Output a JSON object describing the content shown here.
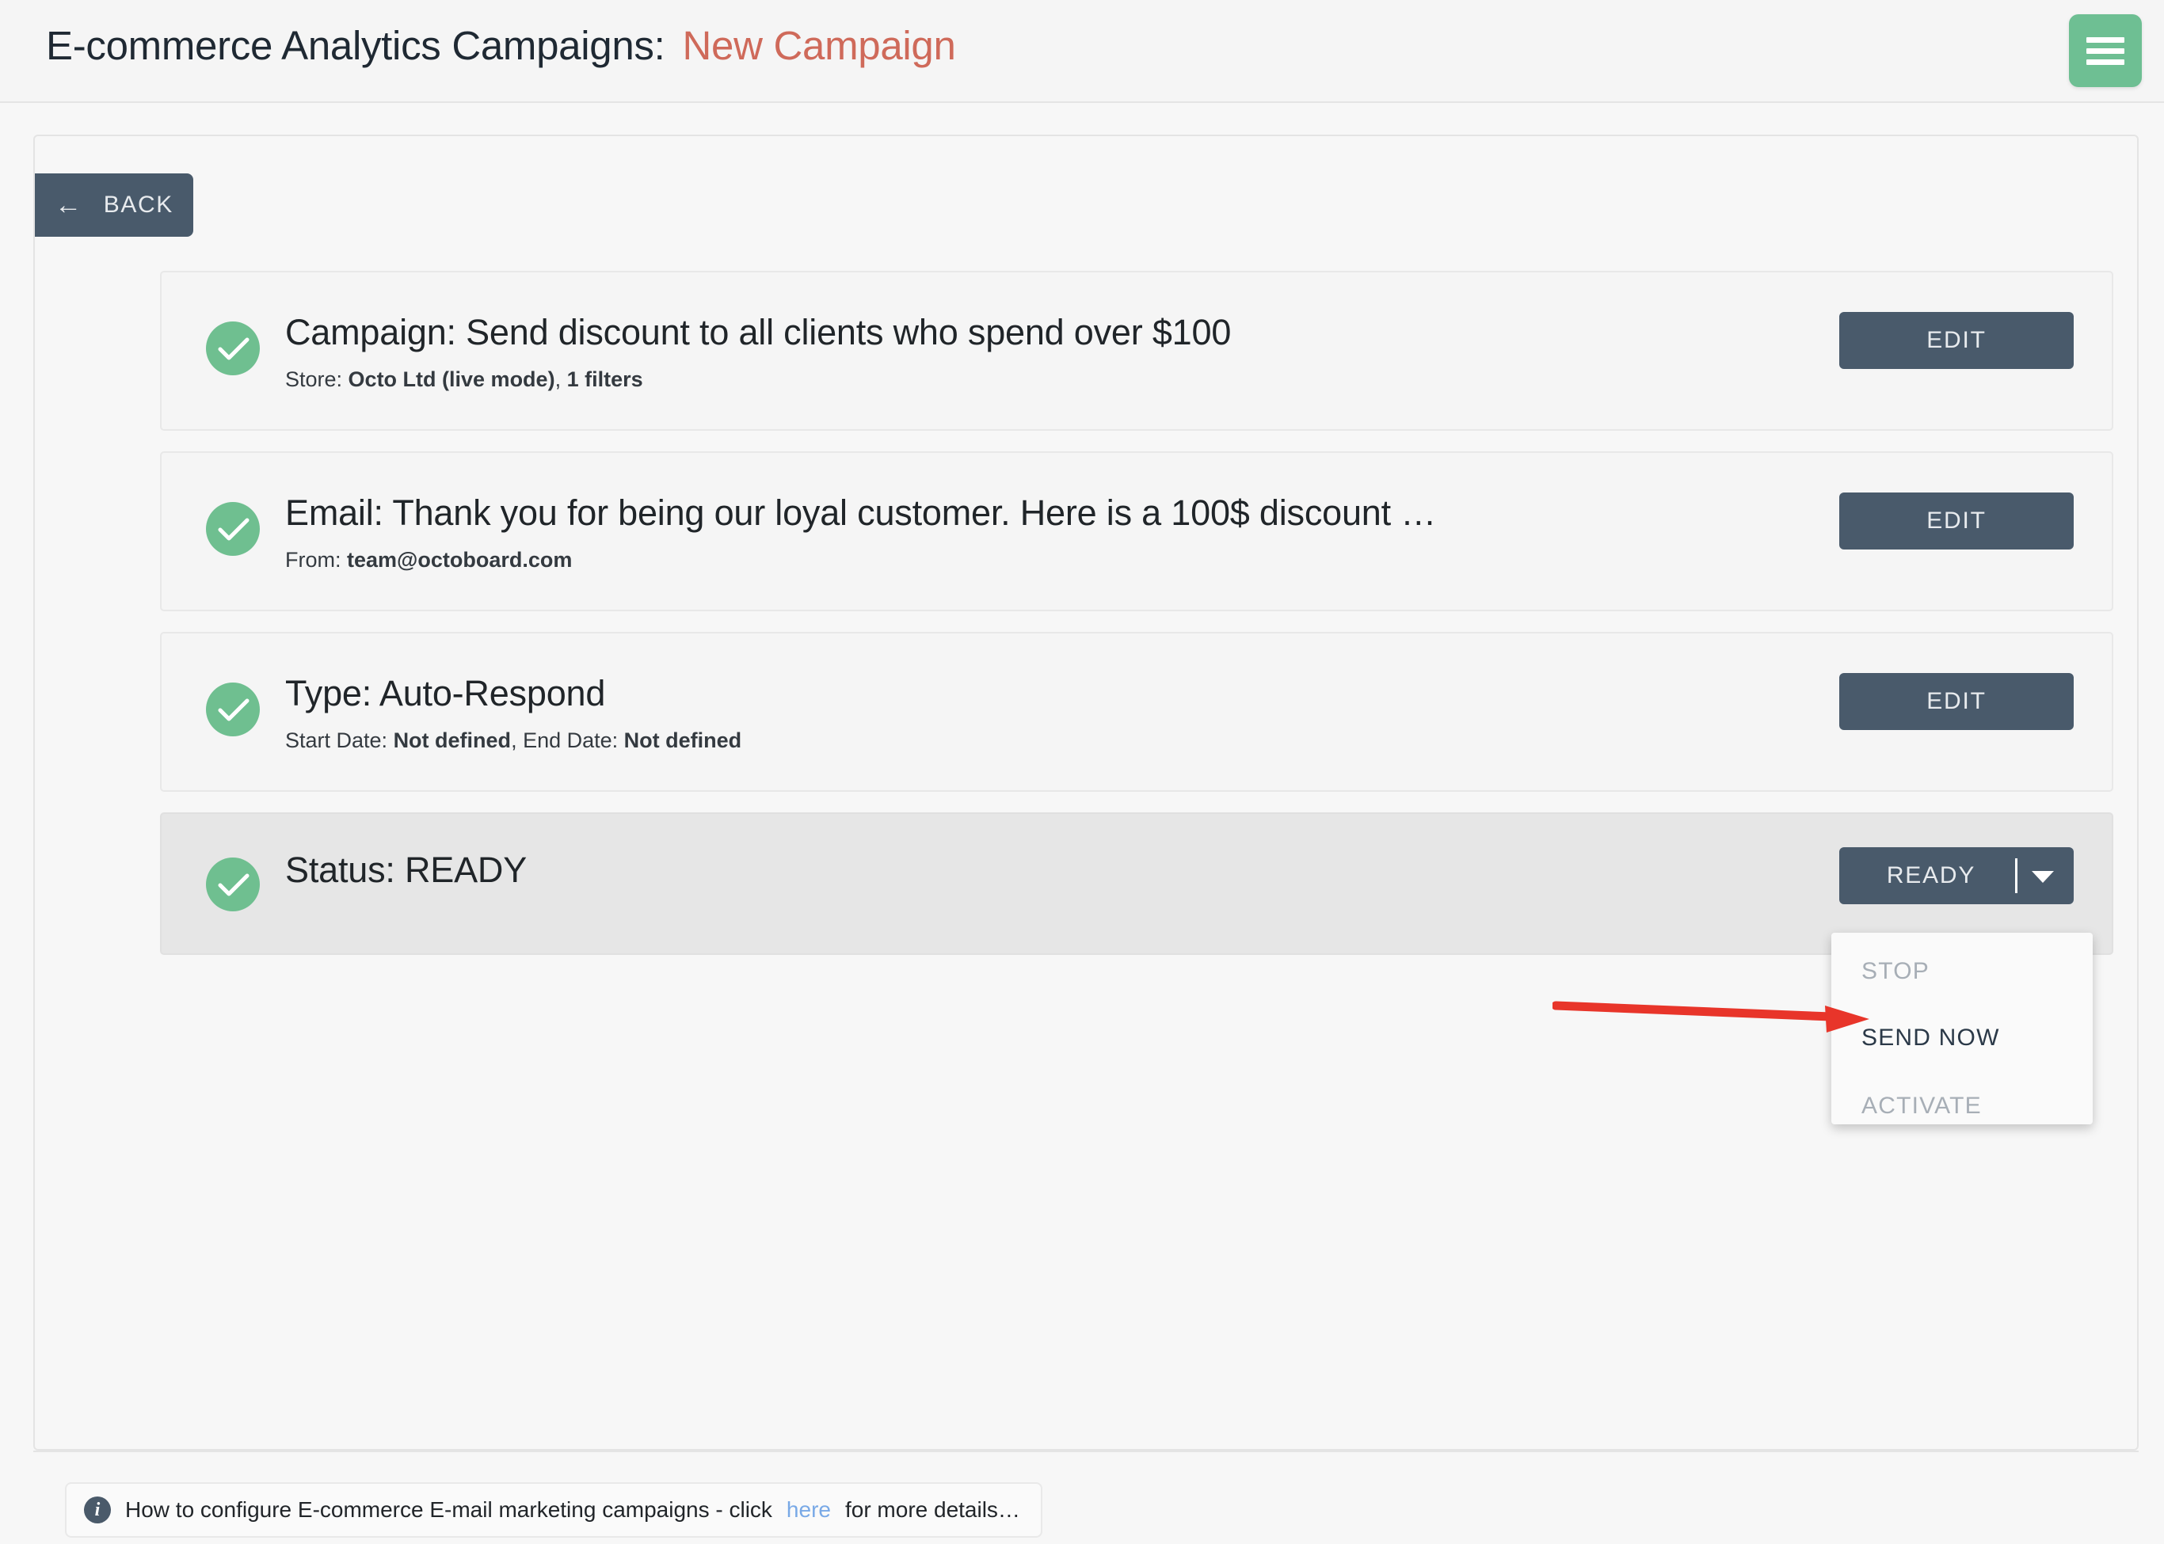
{
  "header": {
    "title": "E-commerce Analytics Campaigns:",
    "subtitle": "New Campaign",
    "accent_color": "#cf6a5a",
    "menu_icon": "hamburger-menu-icon",
    "menu_color": "#6ebf93"
  },
  "toolbar": {
    "back_label": "BACK",
    "back_arrow": "←"
  },
  "steps": [
    {
      "status_icon": "check-circle-icon",
      "title": "Campaign: Send discount to all clients who spend over $100",
      "sub_prefix": "Store: ",
      "sub_bold": "Octo Ltd (live mode)",
      "sub_mid": ", ",
      "sub_bold2": "1 filters",
      "sub_suffix": "",
      "action_label": "EDIT"
    },
    {
      "status_icon": "check-circle-icon",
      "title": "Email: Thank you for being our loyal customer. Here is a 100$ discount …",
      "sub_prefix": "From: ",
      "sub_bold": "team@octoboard.com",
      "sub_mid": "",
      "sub_bold2": "",
      "sub_suffix": "",
      "action_label": "EDIT"
    },
    {
      "status_icon": "check-circle-icon",
      "title": "Type: Auto-Respond",
      "sub_prefix": "Start Date: ",
      "sub_bold": "Not defined",
      "sub_mid": ", End Date: ",
      "sub_bold2": "Not defined",
      "sub_suffix": "",
      "action_label": "EDIT"
    }
  ],
  "status_row": {
    "status_icon": "check-circle-icon",
    "title": "Status: READY",
    "button_label": "READY",
    "caret_icon": "chevron-down-icon"
  },
  "dropdown": {
    "items": [
      {
        "label": "STOP",
        "state": "disabled"
      },
      {
        "label": "SEND NOW",
        "state": "active"
      },
      {
        "label": "ACTIVATE",
        "state": "disabled"
      }
    ]
  },
  "annotation": {
    "arrow_icon": "red-pointer-arrow-icon",
    "color": "#e8352a",
    "points_to": "SEND NOW"
  },
  "footer": {
    "info_icon": "info-icon",
    "text_before": "How to configure E-commerce E-mail marketing campaigns - click",
    "link_label": "here",
    "text_after": "for more details…"
  },
  "colors": {
    "button_dark": "#495a6b",
    "check_green": "#6fbf90",
    "page_bg": "#f7f7f7",
    "card_bg": "#f5f5f5",
    "card_highlight_bg": "#e6e6e6",
    "link_blue": "#79a9e6"
  }
}
